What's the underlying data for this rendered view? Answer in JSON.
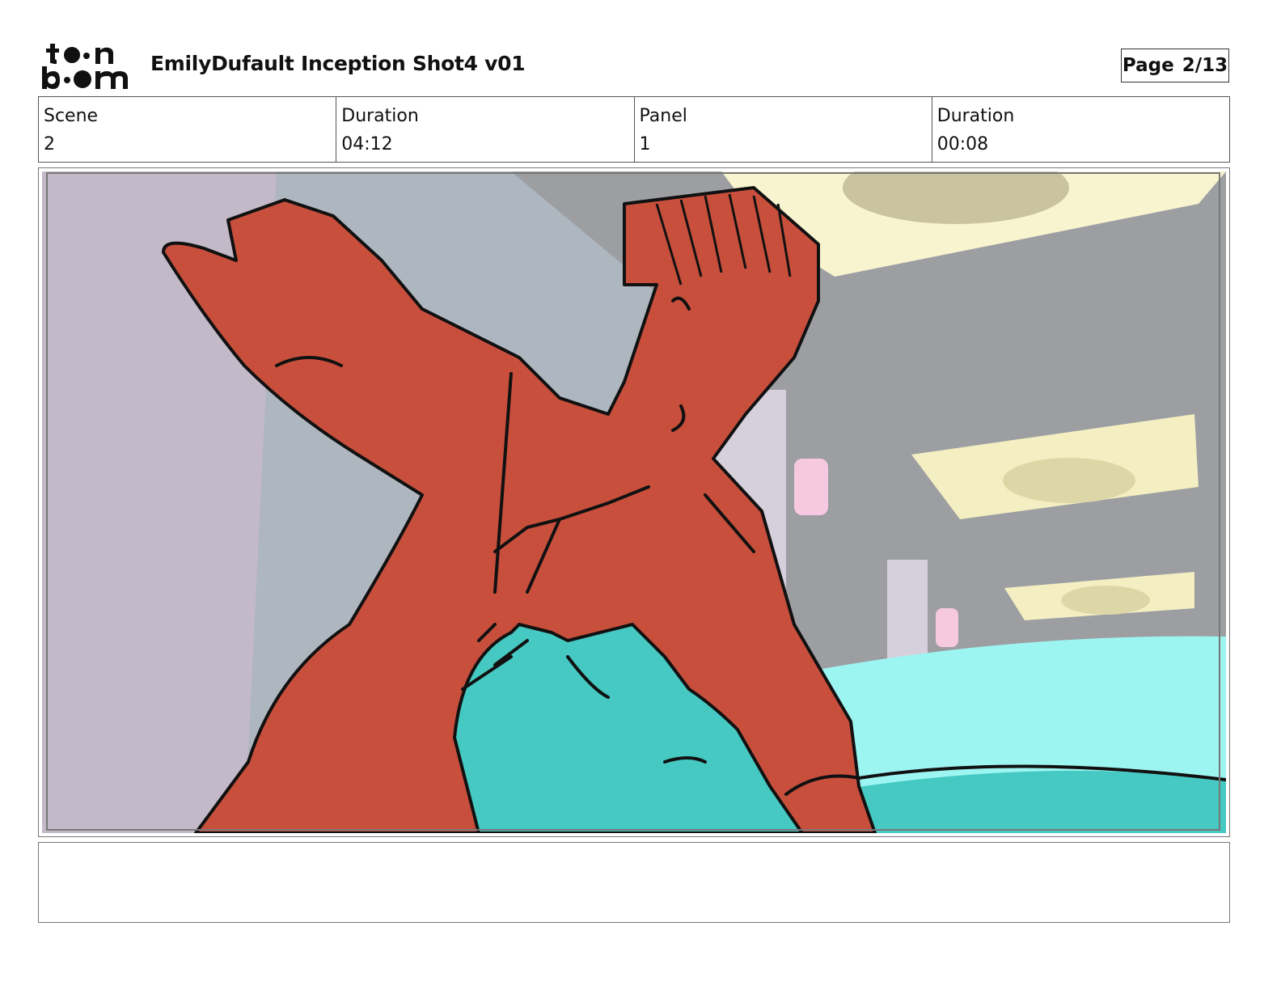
{
  "header": {
    "logo_text": "toon boom",
    "title": "EmilyDufault Inception Shot4 v01",
    "page_label": "Page",
    "page_value": "2/13"
  },
  "info": {
    "scene_label": "Scene",
    "scene_value": "2",
    "scene_duration_label": "Duration",
    "scene_duration_value": "04:12",
    "panel_label": "Panel",
    "panel_value": "1",
    "panel_duration_label": "Duration",
    "panel_duration_value": "00:08"
  },
  "notes": {
    "text": ""
  },
  "colors": {
    "character_red": "#c94f3d",
    "character_teal": "#46c9c2",
    "ceiling_grey": "#9c9ea2",
    "wall_lilac": "#c3b9c9",
    "light_yellow": "#f7f4cf",
    "bed_cyan": "#9df5f2"
  }
}
